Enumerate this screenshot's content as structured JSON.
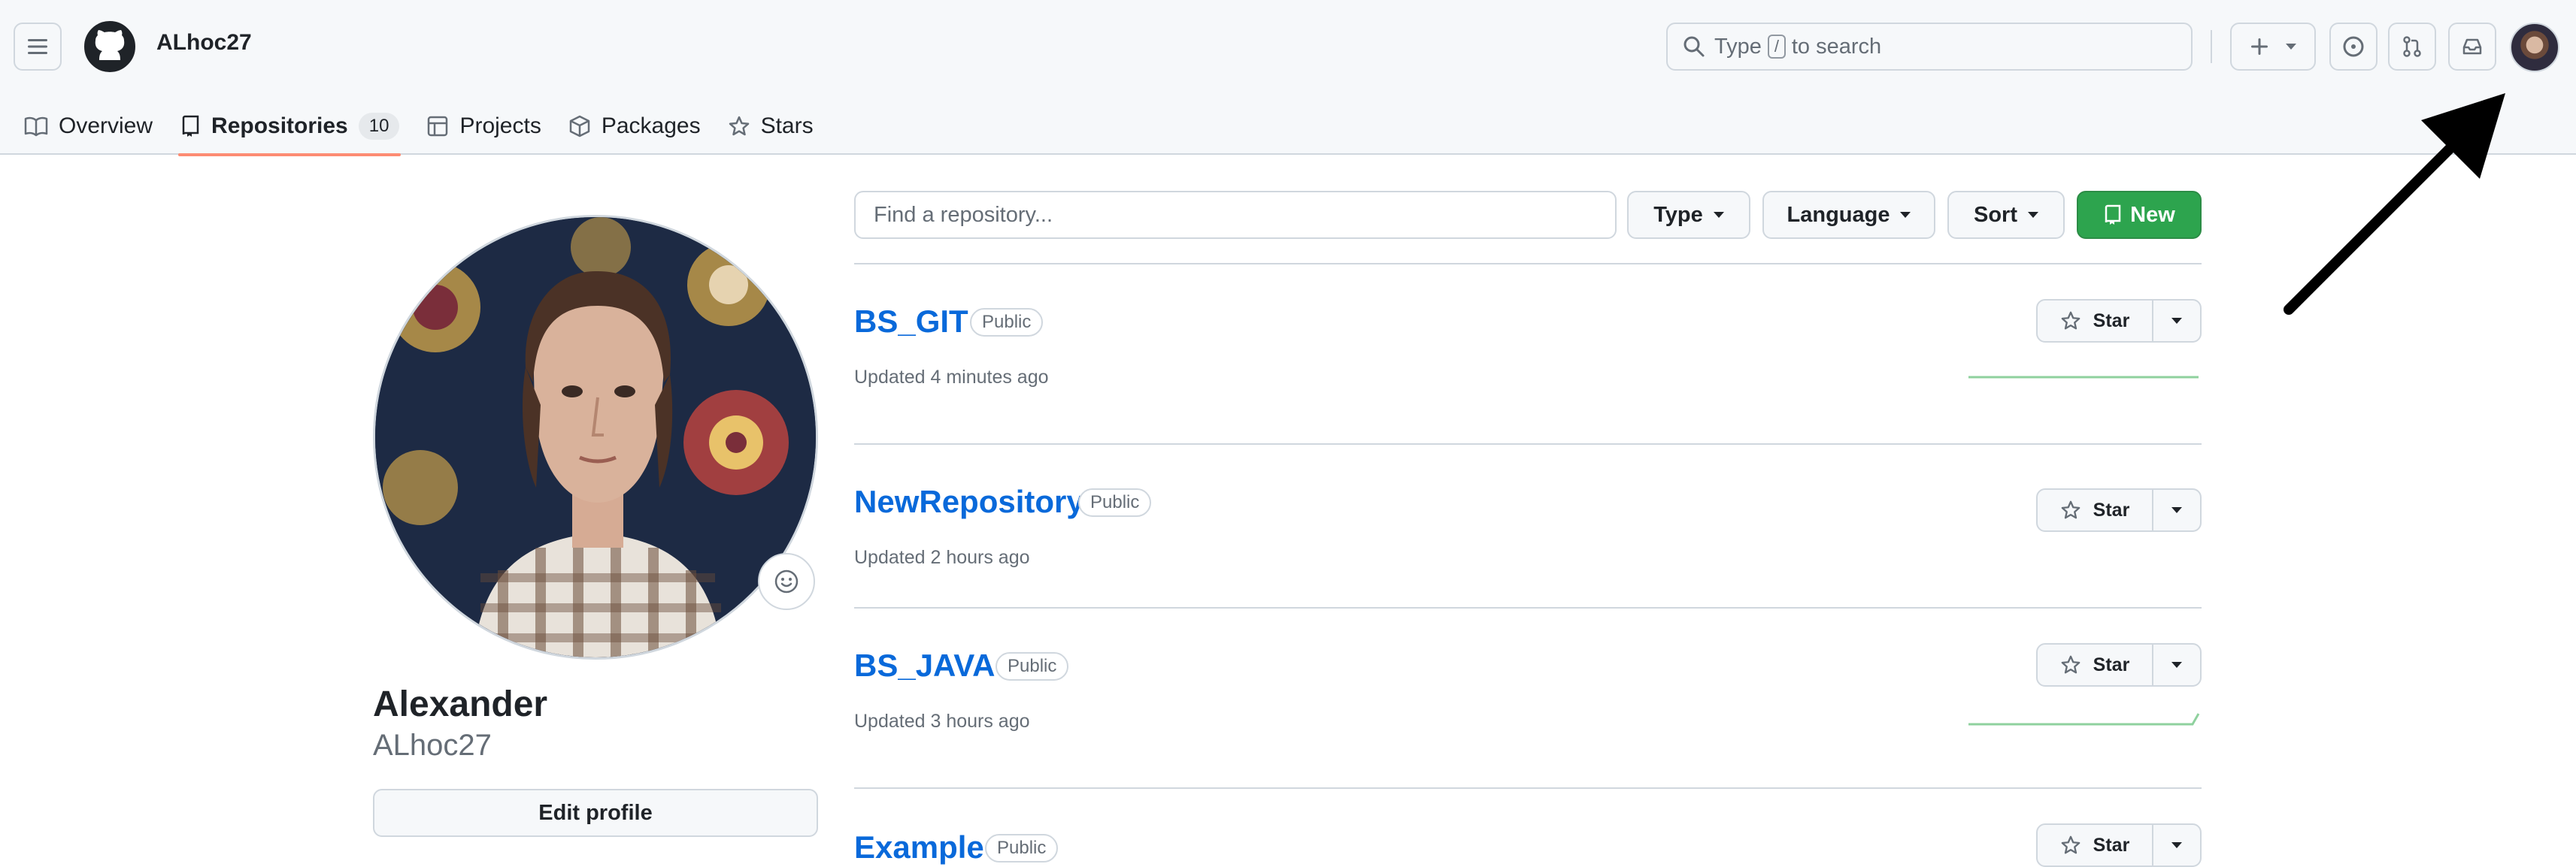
{
  "header": {
    "owner": "ALhoc27",
    "search_prefix": "Type",
    "search_key": "/",
    "search_suffix": "to search"
  },
  "nav": {
    "tabs": [
      {
        "label": "Overview"
      },
      {
        "label": "Repositories",
        "count": "10"
      },
      {
        "label": "Projects"
      },
      {
        "label": "Packages"
      },
      {
        "label": "Stars"
      }
    ]
  },
  "profile": {
    "name": "Alexander",
    "login": "ALhoc27",
    "edit_label": "Edit profile"
  },
  "toolbar": {
    "find_placeholder": "Find a repository...",
    "type_label": "Type",
    "language_label": "Language",
    "sort_label": "Sort",
    "new_label": "New"
  },
  "repos": [
    {
      "name": "BS_GIT",
      "visibility": "Public",
      "updated": "Updated 4 minutes ago",
      "star_label": "Star"
    },
    {
      "name": "NewRepository",
      "visibility": "Public",
      "updated": "Updated 2 hours ago",
      "star_label": "Star"
    },
    {
      "name": "BS_JAVA",
      "visibility": "Public",
      "updated": "Updated 3 hours ago",
      "star_label": "Star"
    },
    {
      "name": "Example",
      "visibility": "Public",
      "updated": "",
      "star_label": "Star"
    }
  ],
  "colors": {
    "accent_tab": "#fd8c73",
    "link": "#0969da",
    "new_button": "#2da44e",
    "sparkline": "#8fd19e"
  }
}
